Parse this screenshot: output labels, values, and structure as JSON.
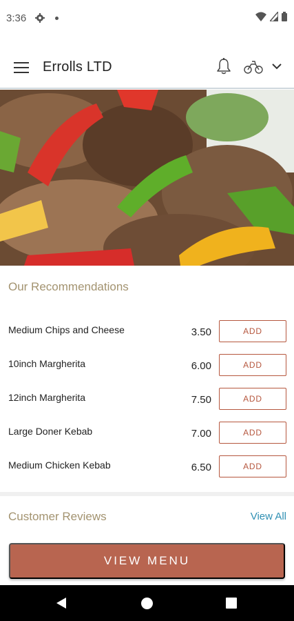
{
  "status_bar": {
    "time": "3:36"
  },
  "app_bar": {
    "title": "Errolls LTD"
  },
  "recommendations": {
    "title": "Our Recommendations",
    "add_label": "ADD",
    "items": [
      {
        "name": "Medium Chips and Cheese",
        "price": "3.50"
      },
      {
        "name": "10inch Margherita",
        "price": "6.00"
      },
      {
        "name": "12inch Margherita",
        "price": "7.50"
      },
      {
        "name": "Large Doner Kebab",
        "price": "7.00"
      },
      {
        "name": "Medium Chicken Kebab",
        "price": "6.50"
      }
    ]
  },
  "reviews": {
    "title": "Customer Reviews",
    "view_all": "View All"
  },
  "view_menu_label": "VIEW MENU",
  "colors": {
    "accent": "#b86550",
    "add_border": "#b5563d",
    "section_title": "#a39370",
    "link": "#2f8fb3"
  }
}
